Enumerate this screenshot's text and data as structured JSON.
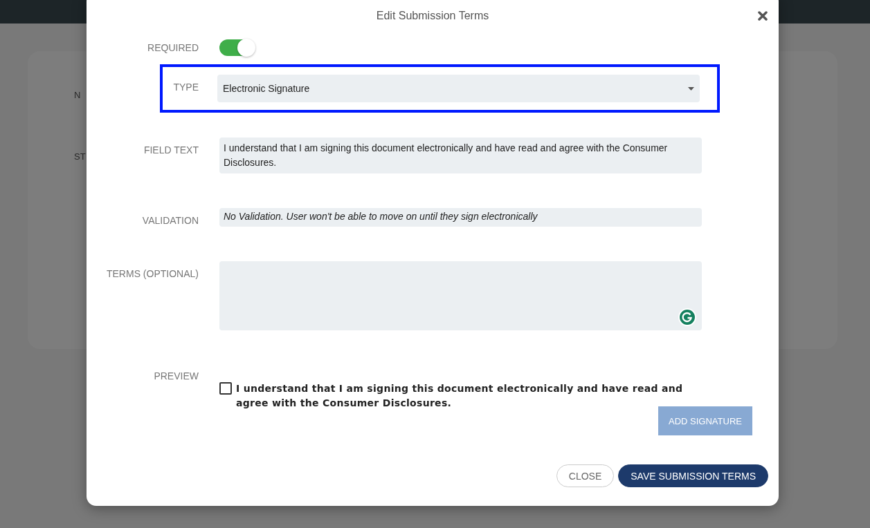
{
  "background": {
    "labels": [
      "N",
      "ST"
    ]
  },
  "dialog": {
    "title": "Edit Submission Terms",
    "required": {
      "label": "REQUIRED",
      "on": true
    },
    "type": {
      "label": "TYPE",
      "value": "Electronic Signature",
      "highlighted": true
    },
    "field_text": {
      "label": "FIELD TEXT",
      "value": "I understand that I am signing this document electronically and have read and agree with the Consumer Disclosures."
    },
    "validation": {
      "label": "VALIDATION",
      "value": "No Validation. User won't be able to move on until they sign electronically"
    },
    "terms": {
      "label": "TERMS (OPTIONAL)"
    },
    "preview": {
      "label": "PREVIEW",
      "checked": false,
      "text": "I understand that I am signing this document electronically and have read and agree with the Consumer Disclosures.",
      "button": {
        "label": "ADD SIGNATURE",
        "disabled": true
      }
    },
    "buttons": [
      {
        "kind": "secondary",
        "label": "CLOSE"
      },
      {
        "kind": "primary",
        "label": "SAVE SUBMISSION TERMS"
      }
    ]
  }
}
